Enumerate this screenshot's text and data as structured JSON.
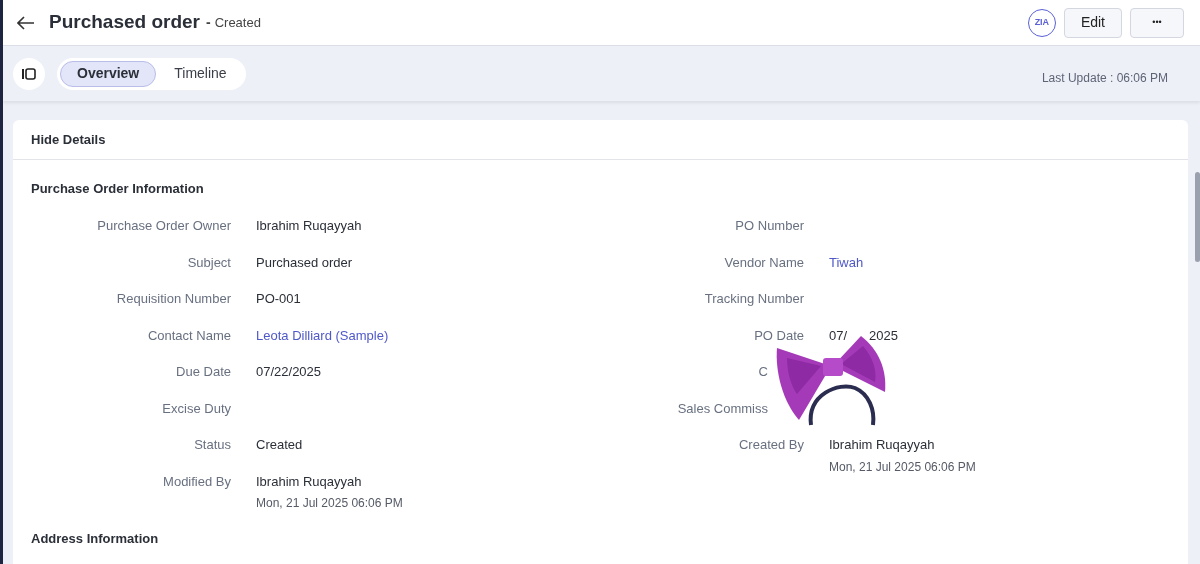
{
  "header": {
    "title": "Purchased order",
    "separator": "-",
    "status": "Created",
    "buttons": [
      {
        "kind": "assistant",
        "label": "ZIA"
      },
      {
        "kind": "text",
        "label": "Edit"
      },
      {
        "kind": "more",
        "label": "•••"
      }
    ]
  },
  "tabs": [
    {
      "label": "Overview",
      "selected": true
    },
    {
      "label": "Timeline",
      "selected": false
    }
  ],
  "last_update": "Last Update : 06:06 PM",
  "card": {
    "toggle": "Hide Details",
    "section": "Purchase Order Information",
    "left_fields": [
      {
        "label": "Purchase Order Owner",
        "value": "Ibrahim Ruqayyah",
        "kind": "text"
      },
      {
        "label": "Subject",
        "value": "Purchased order",
        "kind": "text"
      },
      {
        "label": "Requisition Number",
        "value": "PO-001",
        "kind": "text"
      },
      {
        "label": "Contact Name",
        "value": "Leota Dilliard (Sample)",
        "kind": "link"
      },
      {
        "label": "Due Date",
        "value": "07/22/2025",
        "kind": "text"
      },
      {
        "label": "Excise Duty"
      },
      {
        "label": "Status",
        "value": "Created",
        "kind": "text"
      },
      {
        "label": "Modified By",
        "value": "Ibrahim Ruqayyah",
        "sub": "Mon, 21 Jul 2025 06:06 PM",
        "kind": "text"
      }
    ],
    "right_fields": [
      {
        "label": "PO Number"
      },
      {
        "label": "Vendor Name",
        "value": "Tiwah",
        "kind": "link"
      },
      {
        "label": "Tracking Number"
      },
      {
        "label": "PO Date",
        "value_parts": [
          "07/",
          "2025"
        ],
        "kind": "text"
      },
      {
        "label": "C",
        "covered": true
      },
      {
        "label": "Sales Commiss",
        "covered": true
      },
      {
        "label": "Created By",
        "value": "Ibrahim Ruqayyah",
        "sub": "Mon, 21 Jul 2025 06:06 PM",
        "kind": "text"
      }
    ],
    "next_section": "Address Information"
  },
  "sticker": {
    "kind": "bow"
  }
}
